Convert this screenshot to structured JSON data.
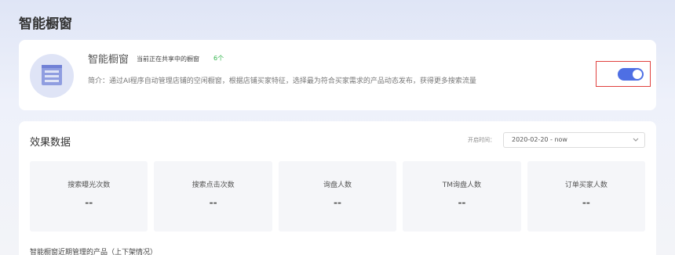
{
  "page": {
    "title": "智能橱窗"
  },
  "feature": {
    "name": "智能橱窗",
    "status_text": "当前正在共享中的橱窗",
    "status_count": "6个",
    "description": "简介：通过AI程序自动管理店铺的空闲橱窗，根据店铺买家特征，选择最为符合买家需求的产品动态发布，获得更多搜索流量",
    "toggle": {
      "on": true,
      "accent": "#4e6fe4"
    },
    "highlight_color": "#e0413e"
  },
  "effect": {
    "title": "效果数据",
    "date_label": "开启时间：",
    "date_value": "2020-02-20 - now",
    "metrics": [
      {
        "label": "搜索曝光次数",
        "value": "--"
      },
      {
        "label": "搜索点击次数",
        "value": "--"
      },
      {
        "label": "询盘人数",
        "value": "--"
      },
      {
        "label": "TM询盘人数",
        "value": "--"
      },
      {
        "label": "订单买家人数",
        "value": "--"
      }
    ],
    "footer_text": "智能橱窗近期管理的产品（上下架情况）"
  }
}
